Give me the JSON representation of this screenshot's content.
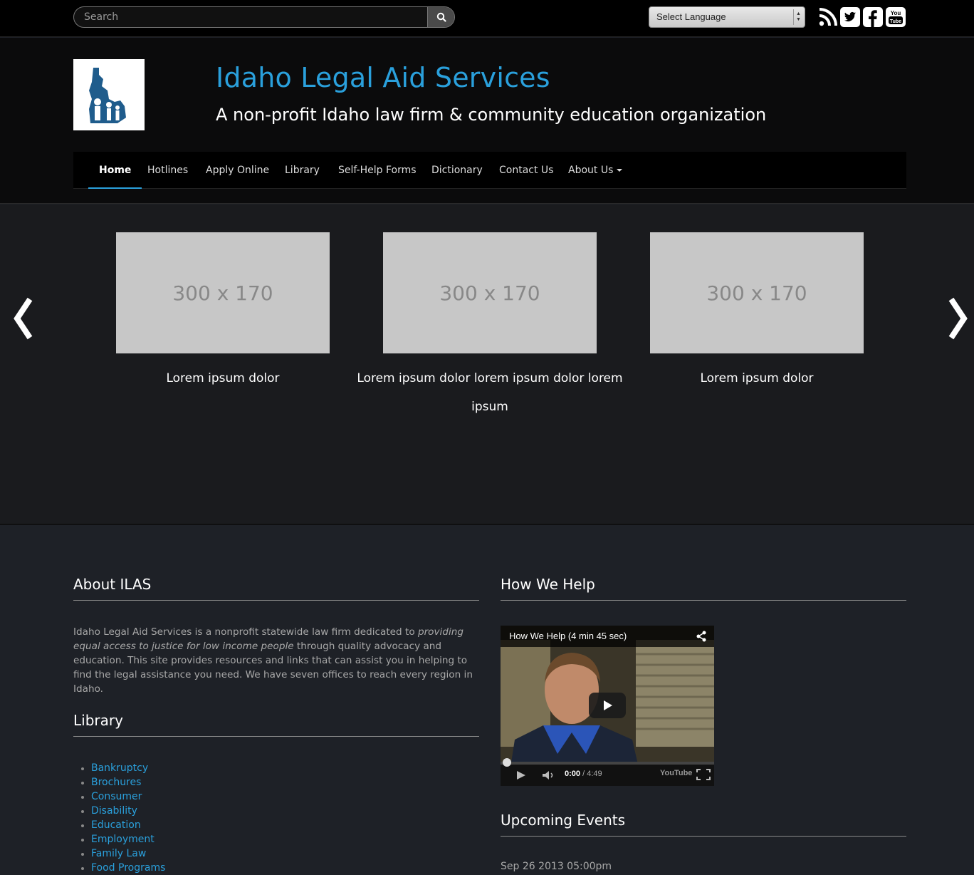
{
  "topbar": {
    "search_placeholder": "Search",
    "language_select": "Select Language",
    "social_icons": [
      "rss-icon",
      "twitter-icon",
      "facebook-icon",
      "youtube-icon"
    ]
  },
  "header": {
    "title": "Idaho Legal Aid Services",
    "tagline": "A non-profit Idaho law firm & community education organization"
  },
  "nav": {
    "items": [
      {
        "label": "Home",
        "active": true
      },
      {
        "label": "Hotlines"
      },
      {
        "label": "Apply Online"
      },
      {
        "label": "Library"
      },
      {
        "label": "Self-Help Forms"
      },
      {
        "label": "Dictionary"
      },
      {
        "label": "Contact Us"
      },
      {
        "label": "About Us"
      }
    ]
  },
  "carousel": {
    "slides": [
      {
        "placeholder": "300 x 170",
        "caption": "Lorem ipsum dolor"
      },
      {
        "placeholder": "300 x 170",
        "caption": "Lorem ipsum dolor lorem ipsum dolor lorem ipsum"
      },
      {
        "placeholder": "300 x 170",
        "caption": "Lorem ipsum dolor"
      }
    ]
  },
  "about": {
    "heading": "About ILAS",
    "text_before": "Idaho Legal Aid Services is a nonprofit statewide law firm dedicated to ",
    "text_emphasis": "providing equal access to justice for low income people",
    "text_after": " through quality advocacy and education. This site provides resources and links that can assist you in helping to find the legal assistance you need. We have seven offices to reach every region in Idaho."
  },
  "library": {
    "heading": "Library",
    "items": [
      "Bankruptcy",
      "Brochures",
      "Consumer",
      "Disability",
      "Education",
      "Employment",
      "Family Law",
      "Food Programs"
    ]
  },
  "how_we_help": {
    "heading": "How We Help",
    "video_title": "How We Help (4 min 45 sec)",
    "current_time": "0:00",
    "duration": "/ 4:49",
    "brand": "YouTube"
  },
  "events": {
    "heading": "Upcoming Events",
    "items": [
      {
        "date": "Sep 26 2013 05:00pm"
      }
    ]
  },
  "colors": {
    "accent": "#2aa0dc",
    "page_bg": "#1e2127",
    "topbar_bg": "#000000"
  }
}
